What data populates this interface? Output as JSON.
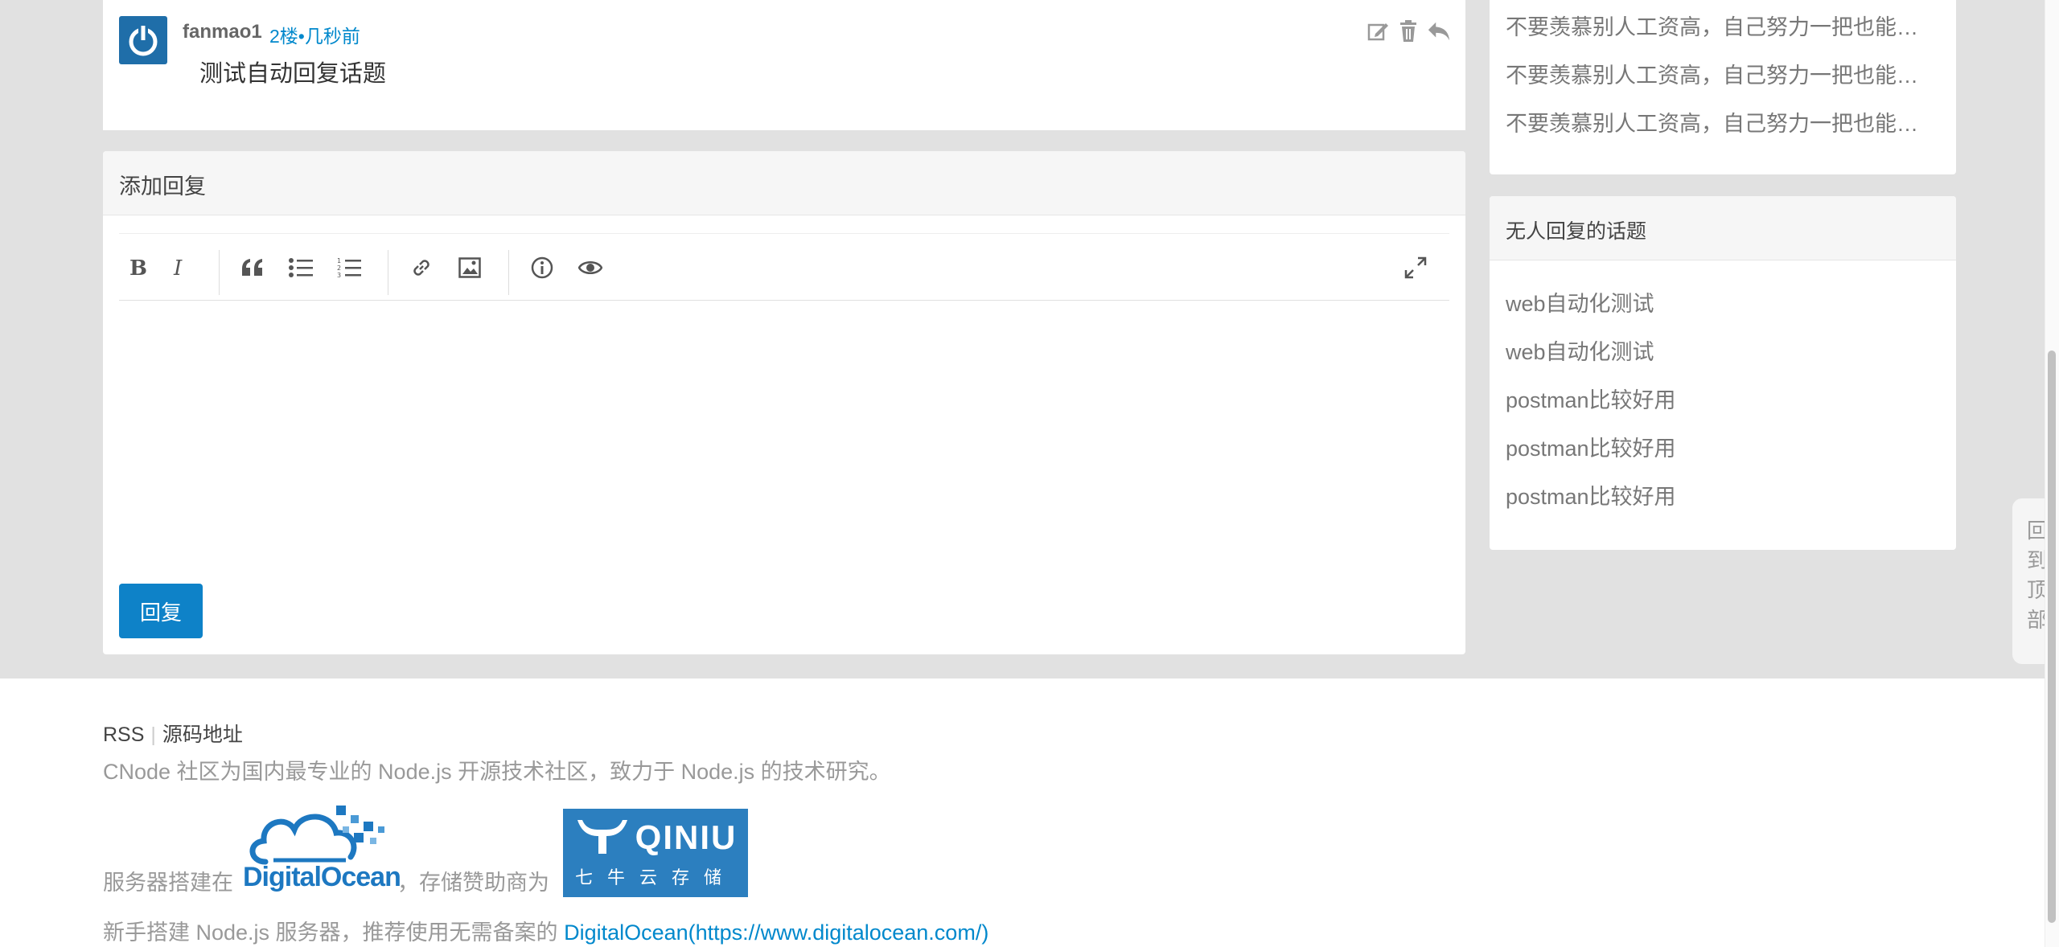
{
  "reply": {
    "author": "fanmao1",
    "meta": "2楼•几秒前",
    "content": "测试自动回复话题"
  },
  "add_reply": {
    "title": "添加回复",
    "submit_label": "回复"
  },
  "sidebar_top": {
    "links": [
      "不要羡慕别人工资高，自己努力一把也能…",
      "不要羡慕别人工资高，自己努力一把也能…",
      "不要羡慕别人工资高，自己努力一把也能…"
    ]
  },
  "no_reply_topics": {
    "title": "无人回复的话题",
    "links": [
      "web自动化测试",
      "web自动化测试",
      "postman比较好用",
      "postman比较好用",
      "postman比较好用"
    ]
  },
  "back_to_top": "回到顶部",
  "footer": {
    "rss": "RSS",
    "source": "源码地址",
    "description": "CNode 社区为国内最专业的 Node.js 开源技术社区，致力于 Node.js 的技术研究。",
    "server_prefix": "服务器搭建在",
    "digitalocean_logo": "DigitalOcean",
    "storage_text": "，存储赞助商为",
    "qiniu_logo": "QINIU",
    "qiniu_sub": "七牛云存储",
    "tip_prefix": "新手搭建 Node.js 服务器，推荐使用无需备案的",
    "tip_link": "DigitalOcean(https://www.digitalocean.com/)"
  },
  "colors": {
    "accent": "#0088cc",
    "button": "#0e82c8",
    "page_bg": "#e1e1e1"
  }
}
